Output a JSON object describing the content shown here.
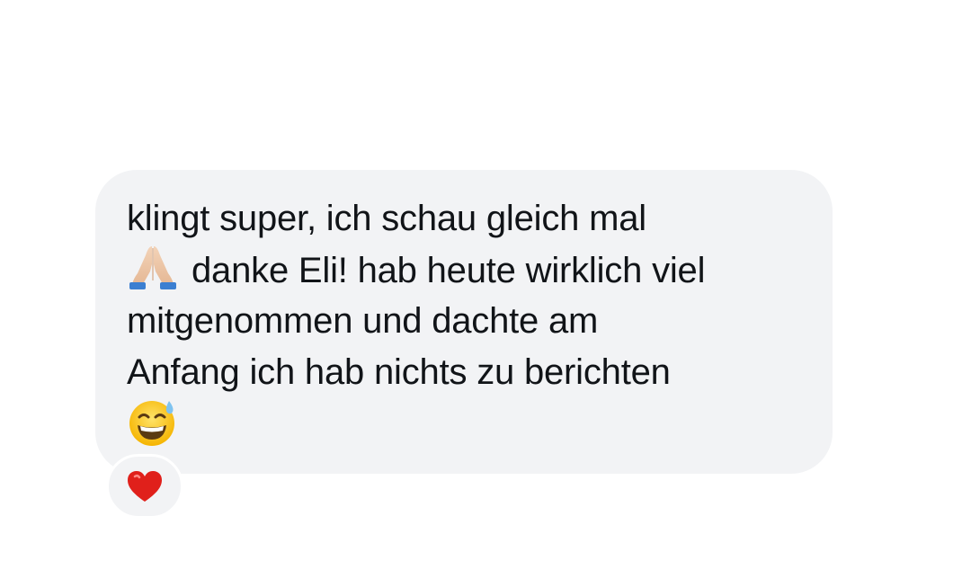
{
  "message": {
    "lines": [
      "klingt super, ich schau gleich mal",
      "danke Eli! hab heute wirklich viel",
      "mitgenommen und dachte am",
      "Anfang ich hab nichts zu berichten"
    ],
    "emojis": [
      "folded-hands-icon",
      "grinning-face-with-sweat-icon"
    ]
  },
  "reaction": {
    "icon": "red-heart-icon",
    "color": "#e0201b"
  },
  "colors": {
    "bubble": "#f2f3f5",
    "text": "#111418",
    "background": "#ffffff"
  }
}
